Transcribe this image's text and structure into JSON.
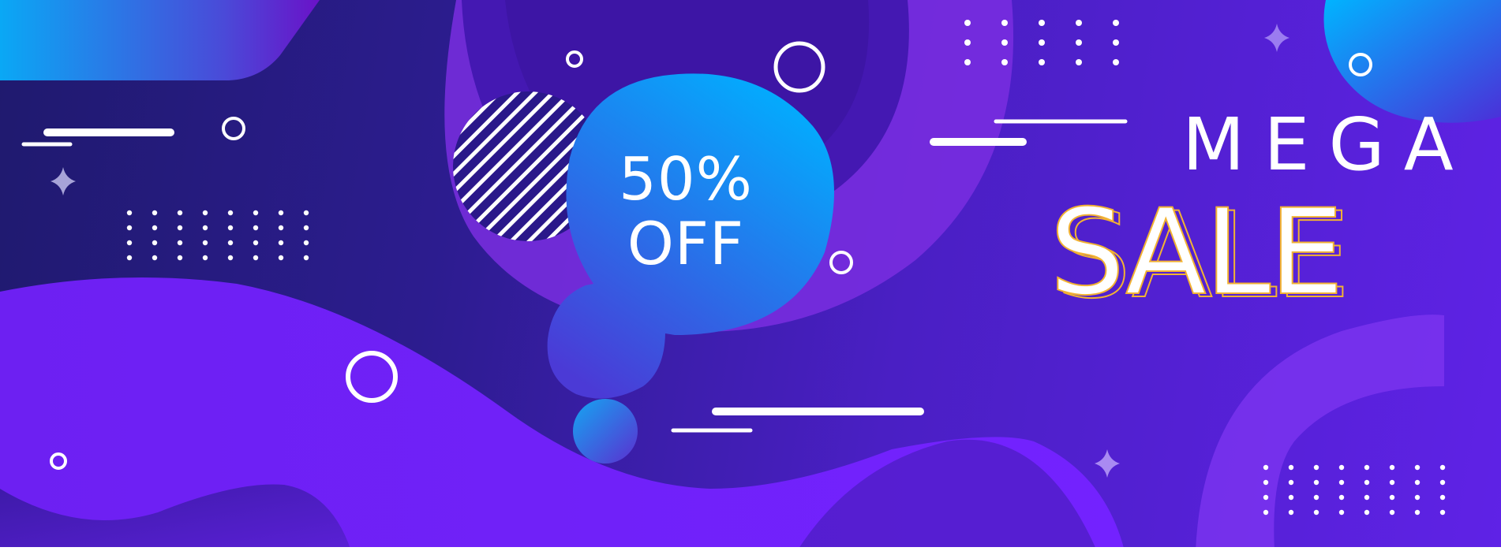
{
  "badge": {
    "line1": "50%",
    "line2": "OFF"
  },
  "headline": {
    "top": "MEGA",
    "bottom": "SALE"
  },
  "colors": {
    "background_dark": "#1f1a6e",
    "background_violet": "#5f22e6",
    "wave_purple": "#6b1ff5",
    "cyan": "#00aaff",
    "outline_gold": "#f2b233",
    "white": "#ffffff"
  }
}
